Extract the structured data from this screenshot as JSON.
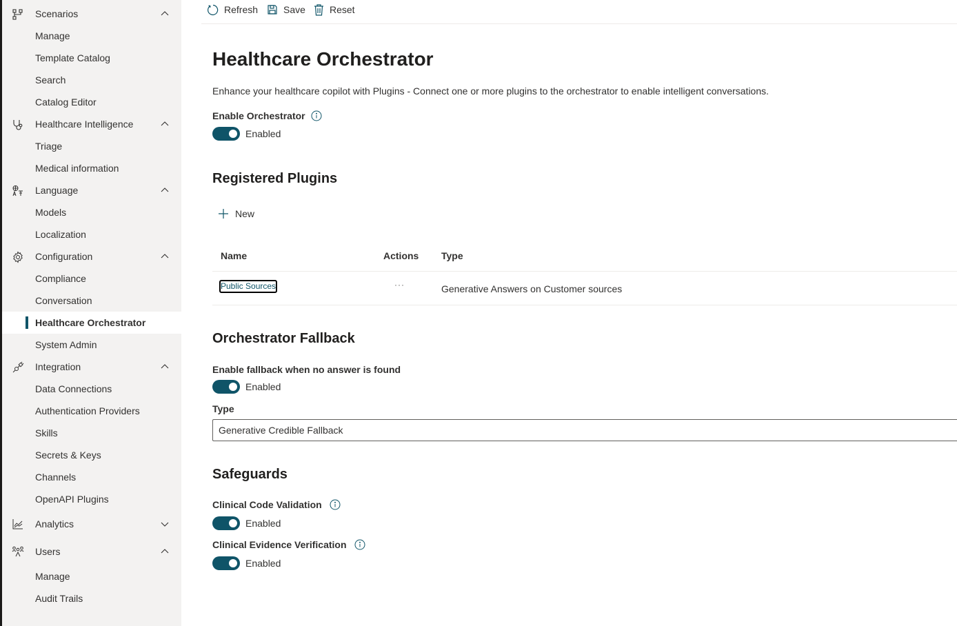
{
  "toolbar": {
    "refresh_label": "Refresh",
    "save_label": "Save",
    "reset_label": "Reset"
  },
  "sidebar": {
    "groups": [
      {
        "label": "Scenarios",
        "icon": "flow-icon",
        "expanded": true,
        "items": [
          "Manage",
          "Template Catalog",
          "Search",
          "Catalog Editor"
        ]
      },
      {
        "label": "Healthcare Intelligence",
        "icon": "stethoscope-icon",
        "expanded": true,
        "items": [
          "Triage",
          "Medical information"
        ]
      },
      {
        "label": "Language",
        "icon": "translate-icon",
        "expanded": true,
        "items": [
          "Models",
          "Localization"
        ]
      },
      {
        "label": "Configuration",
        "icon": "gear-icon",
        "expanded": true,
        "items": [
          "Compliance",
          "Conversation",
          "Healthcare Orchestrator",
          "System Admin"
        ]
      },
      {
        "label": "Integration",
        "icon": "plug-icon",
        "expanded": true,
        "items": [
          "Data Connections",
          "Authentication Providers",
          "Skills",
          "Secrets & Keys",
          "Channels",
          "OpenAPI Plugins"
        ]
      },
      {
        "label": "Analytics",
        "icon": "chart-icon",
        "expanded": false,
        "items": []
      },
      {
        "label": "Users",
        "icon": "people-icon",
        "expanded": true,
        "items": [
          "Manage",
          "Audit Trails"
        ]
      }
    ],
    "active_item": "Healthcare Orchestrator"
  },
  "main": {
    "title": "Healthcare Orchestrator",
    "description": "Enhance your healthcare copilot with Plugins - Connect one or more plugins to the orchestrator to enable intelligent conversations.",
    "enable_orchestrator": {
      "label": "Enable Orchestrator",
      "state": "Enabled",
      "on": true
    },
    "registered_plugins": {
      "title": "Registered Plugins",
      "new_label": "New",
      "columns": [
        "Name",
        "Actions",
        "Type"
      ],
      "rows": [
        {
          "name": "Public Sources",
          "actions": "···",
          "type": "Generative Answers on Customer sources"
        }
      ]
    },
    "fallback": {
      "title": "Orchestrator Fallback",
      "enable_label": "Enable fallback when no answer is found",
      "state": "Enabled",
      "on": true,
      "type_label": "Type",
      "type_value": "Generative Credible Fallback"
    },
    "safeguards": {
      "title": "Safeguards",
      "items": [
        {
          "label": "Clinical Code Validation",
          "state": "Enabled",
          "on": true
        },
        {
          "label": "Clinical Evidence Verification",
          "state": "Enabled",
          "on": true
        }
      ]
    }
  },
  "colors": {
    "accent": "#0f5468",
    "sidebar_bg": "#f3f2f1",
    "text": "#323130"
  }
}
